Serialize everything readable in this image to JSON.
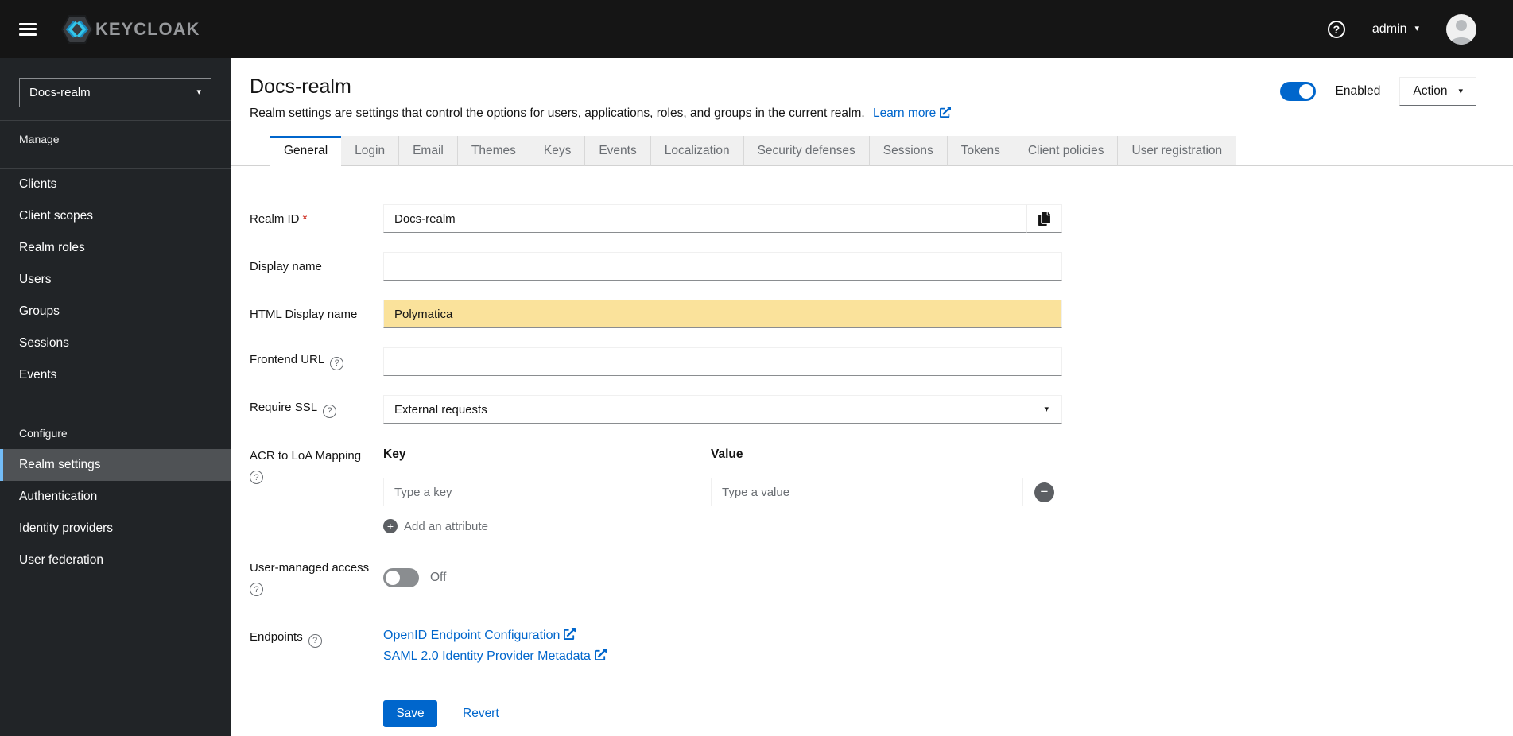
{
  "colors": {
    "accent": "#0066cc",
    "masthead_bg": "#151515",
    "sidebar_bg": "#212427",
    "active_nav_bg": "#4f5255",
    "active_nav_indicator": "#73bcf7",
    "highlight_field_bg": "#fae29b",
    "toggle_off": "#8a8d90"
  },
  "icons": {
    "question": "?",
    "caret_down": "▾",
    "plus": "+",
    "minus": "−"
  },
  "header": {
    "brand": "KEYCLOAK",
    "user": "admin"
  },
  "sidebar": {
    "realm_selector": "Docs-realm",
    "manage_label": "Manage",
    "manage_items": [
      "Clients",
      "Client scopes",
      "Realm roles",
      "Users",
      "Groups",
      "Sessions",
      "Events"
    ],
    "configure_label": "Configure",
    "configure_items": [
      "Realm settings",
      "Authentication",
      "Identity providers",
      "User federation"
    ],
    "active_item": "Realm settings"
  },
  "page": {
    "title": "Docs-realm",
    "description": "Realm settings are settings that control the options for users, applications, roles, and groups in the current realm.",
    "learn_more": "Learn more",
    "enabled_label": "Enabled",
    "action_label": "Action"
  },
  "tabs": {
    "active": "General",
    "items": [
      "General",
      "Login",
      "Email",
      "Themes",
      "Keys",
      "Events",
      "Localization",
      "Security defenses",
      "Sessions",
      "Tokens",
      "Client policies",
      "User registration"
    ]
  },
  "form": {
    "realm_id": {
      "label": "Realm ID",
      "required_marker": "*",
      "value": "Docs-realm"
    },
    "display_name": {
      "label": "Display name",
      "value": ""
    },
    "html_display_name": {
      "label": "HTML Display name",
      "value": "Polymatica"
    },
    "frontend_url": {
      "label": "Frontend URL",
      "value": ""
    },
    "require_ssl": {
      "label": "Require SSL",
      "value": "External requests"
    },
    "acr_mapping": {
      "label": "ACR to LoA Mapping",
      "key_header": "Key",
      "value_header": "Value",
      "key_placeholder": "Type a key",
      "value_placeholder": "Type a value",
      "add_label": "Add an attribute"
    },
    "user_managed_access": {
      "label": "User-managed access",
      "state": "Off"
    },
    "endpoints": {
      "label": "Endpoints",
      "links": [
        "OpenID Endpoint Configuration",
        "SAML 2.0 Identity Provider Metadata"
      ]
    },
    "actions": {
      "save": "Save",
      "revert": "Revert"
    }
  }
}
